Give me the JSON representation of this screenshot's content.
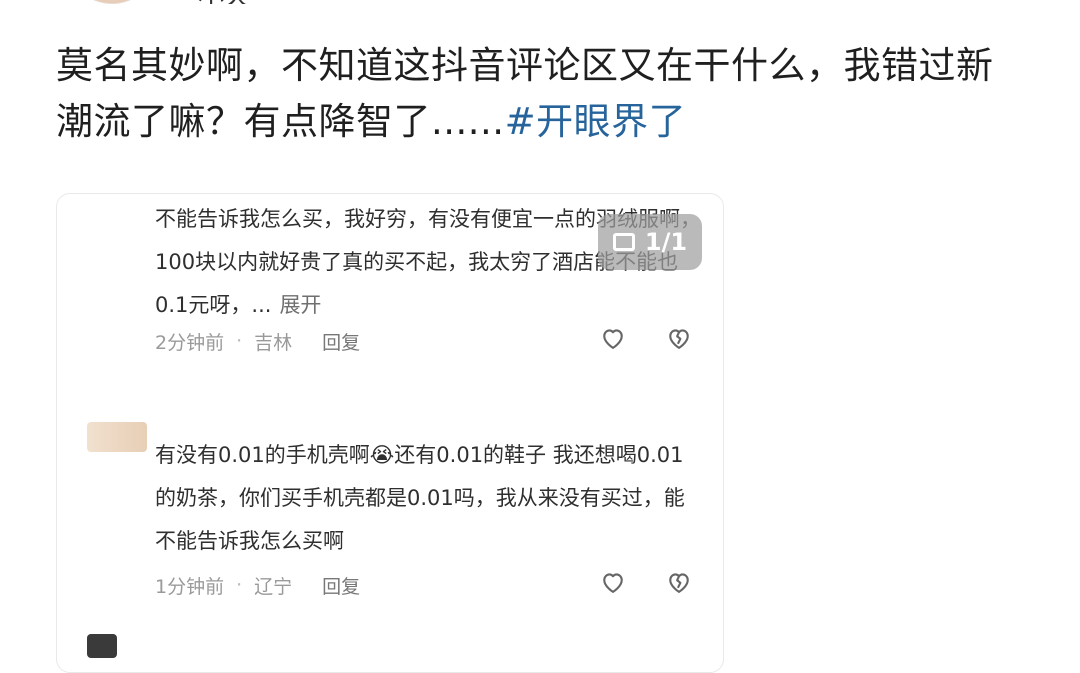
{
  "header": {
    "username": "小天"
  },
  "post": {
    "text": "莫名其妙啊，不知道这抖音评论区又在干什么，我错过新潮流了嘛？有点降智了......",
    "hashtag": "#开眼界了"
  },
  "image_badge": {
    "counter": "1/1",
    "icon": "image-icon"
  },
  "comments": [
    {
      "text": "不能告诉我怎么买，我好穷，有没有便宜一点的羽绒服啊，100块以内就好贵了真的买不起，我太穷了酒店能不能也0.1元呀，...",
      "expand_label": "展开",
      "time": "2分钟前",
      "separator": "·",
      "location": "吉林",
      "reply_label": "回复",
      "like_icon": "heart-outline-icon",
      "dislike_icon": "broken-heart-icon"
    },
    {
      "text": "有没有0.01的手机壳啊😭还有0.01的鞋子 我还想喝0.01的奶茶，你们买手机壳都是0.01吗，我从来没有买过，能不能告诉我怎么买啊",
      "time": "1分钟前",
      "separator": "·",
      "location": "辽宁",
      "reply_label": "回复",
      "like_icon": "heart-outline-icon",
      "dislike_icon": "broken-heart-icon"
    }
  ]
}
